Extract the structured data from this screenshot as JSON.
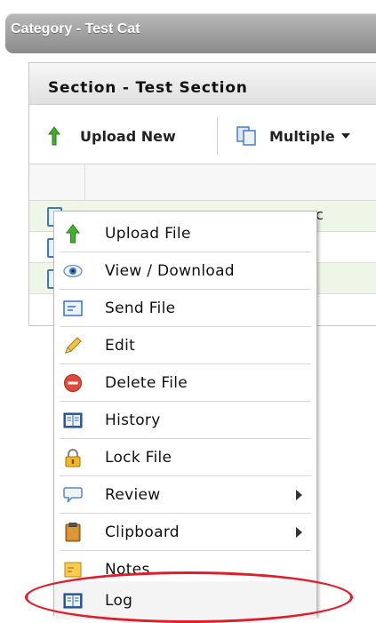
{
  "category": {
    "title": "Category - Test Cat"
  },
  "section": {
    "title": "Section - Test Section"
  },
  "toolbar": {
    "upload_new": "Upload New",
    "multiple": "Multiple"
  },
  "grid": {
    "row_fragment": "c"
  },
  "menu": {
    "items": [
      {
        "label": "Upload File",
        "icon": "green-up-arrow-icon"
      },
      {
        "label": "View / Download",
        "icon": "eye-icon"
      },
      {
        "label": "Send File",
        "icon": "send-file-icon"
      },
      {
        "label": "Edit",
        "icon": "pencil-icon"
      },
      {
        "label": "Delete File",
        "icon": "delete-icon"
      },
      {
        "label": "History",
        "icon": "book-icon"
      },
      {
        "label": "Lock File",
        "icon": "lock-icon"
      },
      {
        "label": "Review",
        "icon": "speech-bubble-icon",
        "submenu": true
      },
      {
        "label": "Clipboard",
        "icon": "clipboard-icon",
        "submenu": true
      },
      {
        "label": "Notes",
        "icon": "notes-icon"
      },
      {
        "label": "Log",
        "icon": "book-icon",
        "highlighted": true
      }
    ]
  },
  "colors": {
    "highlight_ellipse": "#e01d2b",
    "row_green": "#eef7e7",
    "category_bar": "#9a9a9a"
  }
}
